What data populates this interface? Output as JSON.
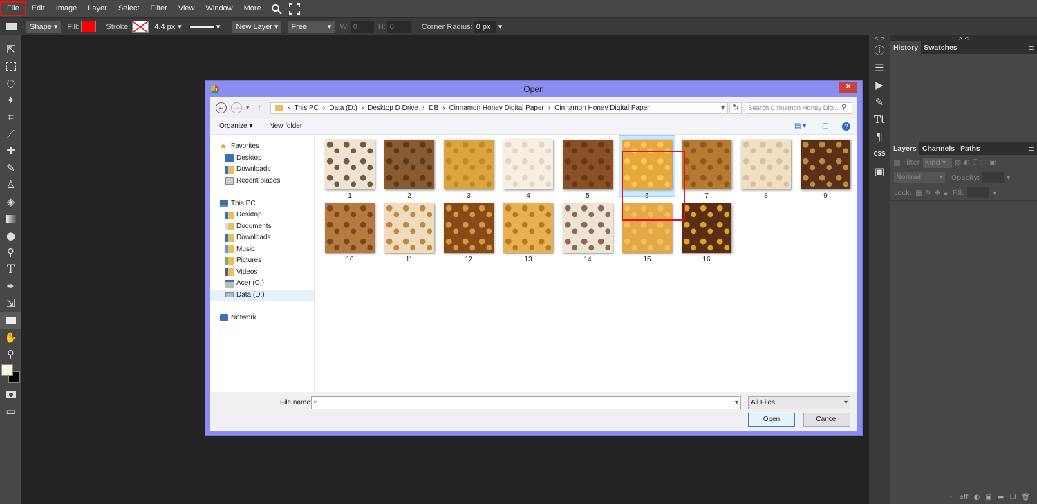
{
  "menu": {
    "items": [
      "File",
      "Edit",
      "Image",
      "Layer",
      "Select",
      "Filter",
      "View",
      "Window",
      "More"
    ]
  },
  "options": {
    "shape_label": "Shape",
    "fill_label": "Fill:",
    "fill_color": "#ff0000",
    "stroke_label": "Stroke:",
    "stroke_width": "4.4 px",
    "new_layer": "New Layer",
    "mode": "Free",
    "w_label": "W:",
    "w_value": "0",
    "h_label": "H:",
    "h_value": "0",
    "corner_label": "Corner Radius:",
    "corner_value": "0 px"
  },
  "right_panel": {
    "tabs_top": [
      "History",
      "Swatches"
    ],
    "tabs_layers": [
      "Layers",
      "Channels",
      "Paths"
    ],
    "filter_label": "Filter",
    "kind_label": "Kind",
    "blend_mode": "Normal",
    "opacity_label": "Opacity:",
    "lock_label": "Lock:",
    "fill_label": "Fill:",
    "footer_link": "eff"
  },
  "dialog": {
    "title": "Open",
    "breadcrumbs": [
      "This PC",
      "Data (D:)",
      "Desktop D Drive",
      "DB",
      "Cinnamon Honey Digital Paper",
      "Cinnamon Honey Digital Paper"
    ],
    "search_placeholder": "Search Cinnamon Honey Digi...",
    "organize": "Organize ▾",
    "new_folder": "New folder",
    "nav": [
      {
        "label": "Favorites",
        "group": true
      },
      {
        "label": "Desktop"
      },
      {
        "label": "Downloads"
      },
      {
        "label": "Recent places"
      },
      {
        "label": "",
        "spacer": true
      },
      {
        "label": "This PC",
        "group": true
      },
      {
        "label": "Desktop"
      },
      {
        "label": "Documents"
      },
      {
        "label": "Downloads"
      },
      {
        "label": "Music"
      },
      {
        "label": "Pictures"
      },
      {
        "label": "Videos"
      },
      {
        "label": "Acer (C:)"
      },
      {
        "label": "Data (D:)",
        "selected": true
      },
      {
        "label": "",
        "spacer": true
      },
      {
        "label": "Network",
        "group": true
      }
    ],
    "files": [
      {
        "label": "1",
        "color": "#efe4d4",
        "accent": "#7a5a3a"
      },
      {
        "label": "2",
        "color": "#8a5a30",
        "accent": "#5a3a1a"
      },
      {
        "label": "3",
        "color": "#dba640",
        "accent": "#c08a28"
      },
      {
        "label": "4",
        "color": "#f6efe2",
        "accent": "#e5d6bd"
      },
      {
        "label": "5",
        "color": "#8a5028",
        "accent": "#6a3818"
      },
      {
        "label": "6",
        "color": "#e8a838",
        "accent": "#f4c864",
        "selected": true
      },
      {
        "label": "7",
        "color": "#b87a30",
        "accent": "#8a5a20"
      },
      {
        "label": "8",
        "color": "#f1e0c4",
        "accent": "#d9c29a"
      },
      {
        "label": "9",
        "color": "#5a3018",
        "accent": "#c08a40"
      },
      {
        "label": "10",
        "color": "#b6793e",
        "accent": "#7a4820"
      },
      {
        "label": "11",
        "color": "#f0dcbc",
        "accent": "#c08840"
      },
      {
        "label": "12",
        "color": "#8a4a18",
        "accent": "#d29a40"
      },
      {
        "label": "13",
        "color": "#e8b050",
        "accent": "#b87828"
      },
      {
        "label": "14",
        "color": "#efe3d6",
        "accent": "#8a6a50"
      },
      {
        "label": "15",
        "color": "#e4a846",
        "accent": "#f0c060"
      },
      {
        "label": "16",
        "color": "#5a2e12",
        "accent": "#e0a030"
      }
    ],
    "file_name_label": "File name:",
    "file_name_value": "6",
    "file_type": "All Files",
    "open_btn": "Open",
    "cancel_btn": "Cancel"
  }
}
